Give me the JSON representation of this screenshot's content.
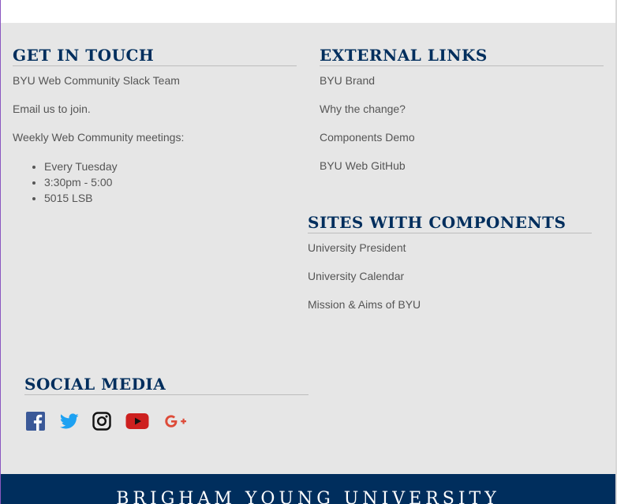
{
  "get_in_touch": {
    "heading": "GET IN TOUCH",
    "slack_link": "BYU Web Community Slack Team",
    "email_link": "Email us to join.",
    "meetings_text": "Weekly Web Community meetings:",
    "meeting_details": [
      "Every Tuesday",
      "3:30pm - 5:00",
      "5015 LSB"
    ]
  },
  "external_links": {
    "heading": "EXTERNAL LINKS",
    "links": [
      "BYU Brand",
      "Why the change?",
      "Components Demo",
      "BYU Web GitHub"
    ]
  },
  "sites_with_components": {
    "heading": "SITES WITH COMPONENTS",
    "links": [
      "University President",
      "University Calendar",
      "Mission & Aims of BYU"
    ]
  },
  "social_media": {
    "heading": "SOCIAL MEDIA",
    "icons": [
      "facebook-icon",
      "twitter-icon",
      "instagram-icon",
      "youtube-icon",
      "google-plus-icon"
    ]
  },
  "footer": {
    "title": "BRIGHAM YOUNG UNIVERSITY"
  },
  "colors": {
    "brand_navy": "#002e5d",
    "panel_bg": "#e6e6e6",
    "text": "#555555",
    "facebook": "#3b5998",
    "twitter": "#1da1f2",
    "youtube": "#cd201f",
    "google_plus": "#dd4b39"
  }
}
